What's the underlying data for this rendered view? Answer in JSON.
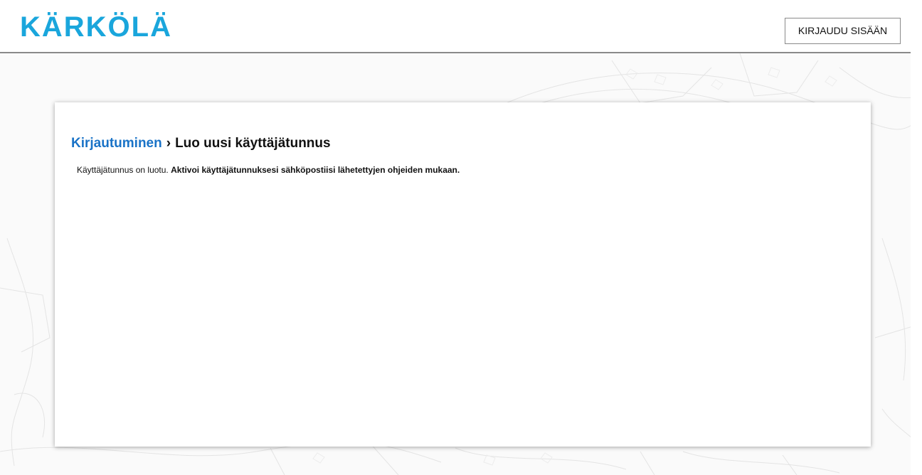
{
  "header": {
    "logo_text": "KÄRKÖLÄ",
    "login_button_label": "KIRJAUDU SISÄÄN"
  },
  "breadcrumb": {
    "parent_label": "Kirjautuminen",
    "separator": "›",
    "current_label": "Luo uusi käyttäjätunnus"
  },
  "message": {
    "normal_text": "Käyttäjätunnus on luotu.",
    "bold_text": "Aktivoi käyttäjätunnuksesi sähköpostiisi lähetettyjen ohjeiden mukaan."
  },
  "colors": {
    "brand": "#1aa6dc",
    "link": "#1a73c7",
    "text": "#111111"
  }
}
